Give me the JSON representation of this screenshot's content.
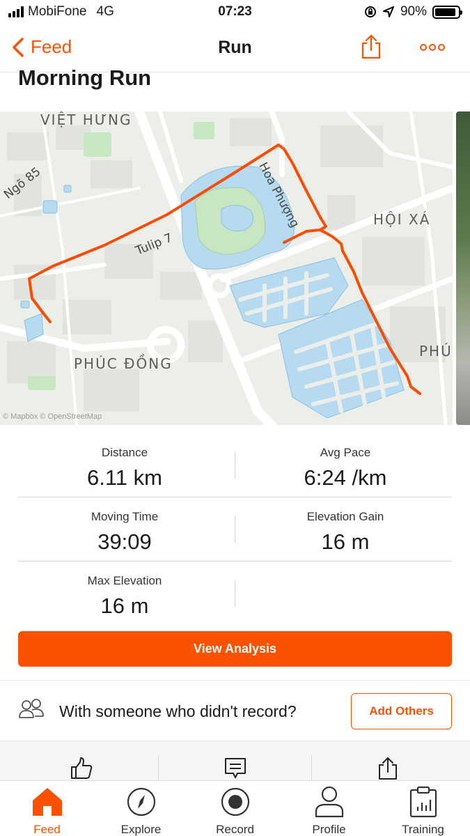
{
  "status_bar": {
    "carrier": "MobiFone",
    "network": "4G",
    "time": "07:23",
    "battery": "90%",
    "battery_level": 0.9
  },
  "nav": {
    "back_label": "Feed",
    "title": "Run",
    "icons": [
      "chevron-left-icon",
      "share-icon",
      "more-icon"
    ]
  },
  "activity": {
    "title": "Morning Run"
  },
  "map": {
    "labels": {
      "viet_hung": "VIỆT HƯNG",
      "hoi_xa": "HỘI XÁ",
      "phuc_dong": "PHÚC ĐỒNG",
      "phu": "PHÚ",
      "ngo85": "Ngõ 85",
      "tulip7": "Tulip 7",
      "hoa_phuong": "Hoa Phượng"
    },
    "attribution": "© Mapbox © OpenStreetMap",
    "route_color": "#fc4c02"
  },
  "stats": [
    {
      "label": "Distance",
      "value": "6.11 km"
    },
    {
      "label": "Avg Pace",
      "value": "6:24 /km"
    },
    {
      "label": "Moving Time",
      "value": "39:09"
    },
    {
      "label": "Elevation Gain",
      "value": "16 m"
    },
    {
      "label": "Max Elevation",
      "value": "16 m"
    }
  ],
  "view_analysis_label": "View Analysis",
  "with_others": {
    "text": "With someone who didn't record?",
    "button": "Add Others"
  },
  "actions": [
    "thumbs-up-icon",
    "comment-icon",
    "share-icon"
  ],
  "tabs": [
    {
      "label": "Feed",
      "icon": "home-icon",
      "active": true
    },
    {
      "label": "Explore",
      "icon": "compass-icon",
      "active": false
    },
    {
      "label": "Record",
      "icon": "record-icon",
      "active": false
    },
    {
      "label": "Profile",
      "icon": "person-icon",
      "active": false
    },
    {
      "label": "Training",
      "icon": "training-icon",
      "active": false
    }
  ],
  "colors": {
    "accent": "#fc5200"
  }
}
